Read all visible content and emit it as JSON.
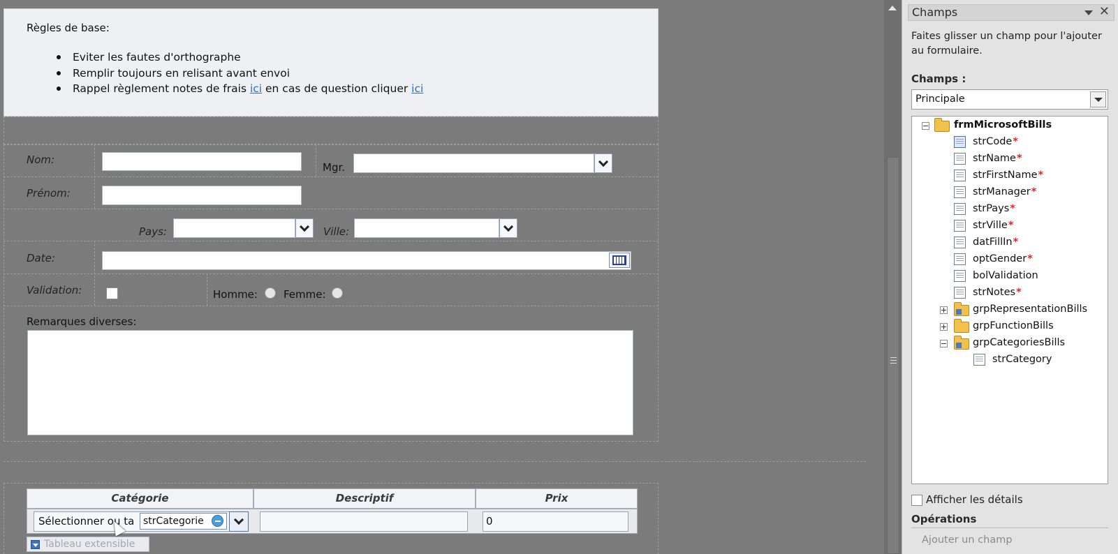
{
  "rules": {
    "title": "Règles de base:",
    "items": [
      "Eviter les fautes d'orthographe",
      "Remplir toujours en relisant avant envoi"
    ],
    "item3_prefix": "Rappel règlement notes de frais ",
    "item3_link1": "ici",
    "item3_middle": " en cas de question cliquer ",
    "item3_link2": "ici"
  },
  "form": {
    "nom_label": "Nom:",
    "mgr_label": "Mgr.",
    "prenom_label": "Prénom:",
    "pays_label": "Pays:",
    "ville_label": "Ville:",
    "date_label": "Date:",
    "validation_label": "Validation:",
    "homme_label": "Homme:",
    "femme_label": "Femme:",
    "remarques_label": "Remarques diverses:"
  },
  "table": {
    "headers": [
      "Catégorie",
      "Descriptif",
      "Prix"
    ],
    "categorie_value": "Sélectionner ou ta",
    "drag_chip": "strCategorie",
    "prix_value": "0",
    "extensible_label": "Tableau extensible"
  },
  "pane": {
    "title": "Champs",
    "description": "Faites glisser un champ pour l'ajouter au formulaire.",
    "fields_label": "Champs :",
    "source_selected": "Principale",
    "tree": {
      "root": "frmMicrosoftBills",
      "fields": [
        {
          "name": "strCode",
          "required": "*"
        },
        {
          "name": "strName",
          "required": "*"
        },
        {
          "name": "strFirstName",
          "required": "*"
        },
        {
          "name": "strManager",
          "required": "*"
        },
        {
          "name": "strPays",
          "required": "*"
        },
        {
          "name": "strVille",
          "required": "*"
        },
        {
          "name": "datFillIn",
          "required": "*"
        },
        {
          "name": "optGender",
          "required": "*"
        },
        {
          "name": "bolValidation",
          "required": ""
        },
        {
          "name": "strNotes",
          "required": "*"
        }
      ],
      "groups": [
        "grpRepresentationBills",
        "grpFunctionBills",
        "grpCategoriesBills"
      ],
      "subfield": "strCategory"
    },
    "details_label": "Afficher les détails",
    "operations_label": "Opérations",
    "add_field": "Ajouter un champ"
  },
  "colors": {
    "canvas": "#7b7b7b",
    "link": "#2f6fc3",
    "required": "#e0242e"
  }
}
